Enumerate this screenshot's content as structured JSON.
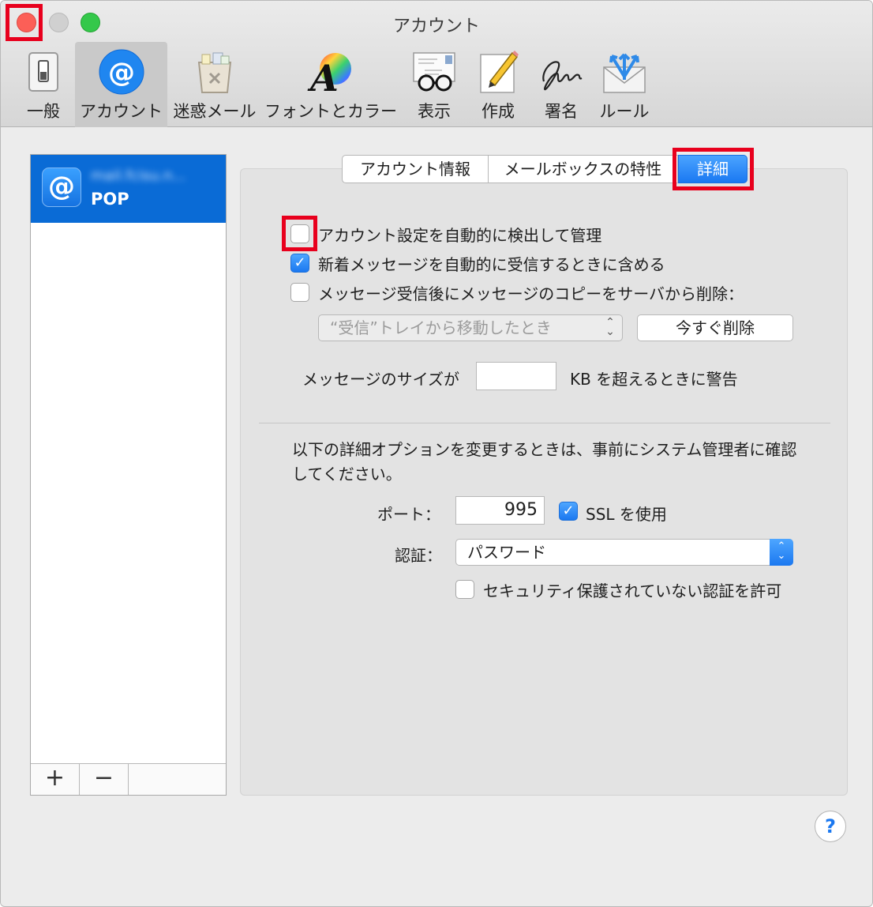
{
  "window": {
    "title": "アカウント"
  },
  "toolbar": {
    "items": [
      {
        "label": "一般",
        "icon": "switch-icon"
      },
      {
        "label": "アカウント",
        "icon": "at-icon"
      },
      {
        "label": "迷惑メール",
        "icon": "trash-icon"
      },
      {
        "label": "フォントとカラー",
        "icon": "font-color-icon"
      },
      {
        "label": "表示",
        "icon": "envelope-glasses-icon"
      },
      {
        "label": "作成",
        "icon": "pencil-paper-icon"
      },
      {
        "label": "署名",
        "icon": "signature-icon"
      },
      {
        "label": "ルール",
        "icon": "rules-envelope-icon"
      }
    ],
    "active": "アカウント"
  },
  "accounts": {
    "items": [
      {
        "name": "mail.fcisu.n...",
        "type": "POP",
        "icon": "at-icon"
      }
    ],
    "add_label": "+",
    "remove_label": "−"
  },
  "tabs": {
    "items": [
      "アカウント情報",
      "メールボックスの特性",
      "詳細"
    ],
    "selected": "詳細"
  },
  "options": {
    "auto_detect": {
      "label": "アカウント設定を自動的に検出して管理",
      "checked": false
    },
    "include_new": {
      "label": "新着メッセージを自動的に受信するときに含める",
      "checked": true
    },
    "remove_copy": {
      "label": "メッセージ受信後にメッセージのコピーをサーバから削除：",
      "checked": false
    },
    "remove_when": {
      "value": "“受信”トレイから移動したとき",
      "disabled": true
    },
    "remove_now_label": "今すぐ削除",
    "size_warning_prefix": "メッセージのサイズが",
    "size_warning_value": "",
    "size_warning_suffix": "KB を超えるときに警告"
  },
  "advanced": {
    "note": "以下の詳細オプションを変更するときは、事前にシステム管理者に確認してください。",
    "port_label": "ポート：",
    "port_value": "995",
    "ssl": {
      "label": "SSL を使用",
      "checked": true
    },
    "auth_label": "認証：",
    "auth_value": "パスワード",
    "insecure_auth": {
      "label": "セキュリティ保護されていない認証を許可",
      "checked": false
    }
  },
  "help_label": "?",
  "colors": {
    "selection_blue": "#0a6bd6",
    "accent_blue": "#1b78f0",
    "highlight_red": "#e8001d",
    "close": "#fc5f57",
    "zoom": "#34c84a"
  }
}
